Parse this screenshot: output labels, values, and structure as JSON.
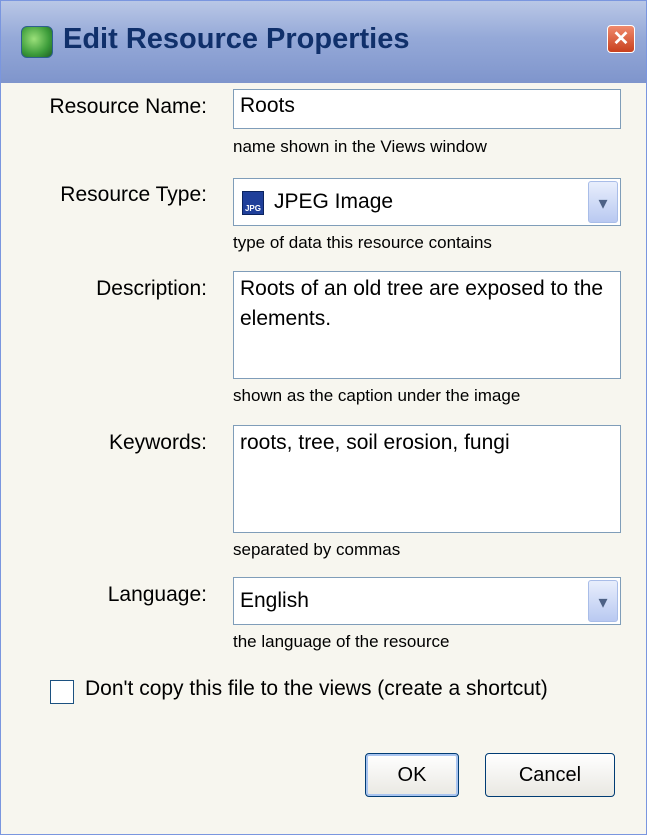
{
  "window": {
    "title": "Edit Resource Properties",
    "close_glyph": "✕"
  },
  "resource_name": {
    "label": "Resource Name:",
    "value": "Roots",
    "hint": "name shown in the Views window"
  },
  "resource_type": {
    "label": "Resource Type:",
    "icon_text": "JPG",
    "value": "JPEG Image",
    "hint": "type of data this resource contains"
  },
  "description": {
    "label": "Description:",
    "value": "Roots of an old tree are exposed to the elements.",
    "hint": "shown as the caption under the image"
  },
  "keywords": {
    "label": "Keywords:",
    "value": "roots, tree, soil erosion, fungi",
    "hint": "separated by commas"
  },
  "language": {
    "label": "Language:",
    "value": "English",
    "hint": "the language of the resource"
  },
  "shortcut_option": {
    "label": "Don't copy this file to the views (create a shortcut)",
    "checked": false
  },
  "buttons": {
    "ok": "OK",
    "cancel": "Cancel"
  },
  "icons": {
    "dropdown": "▾"
  }
}
